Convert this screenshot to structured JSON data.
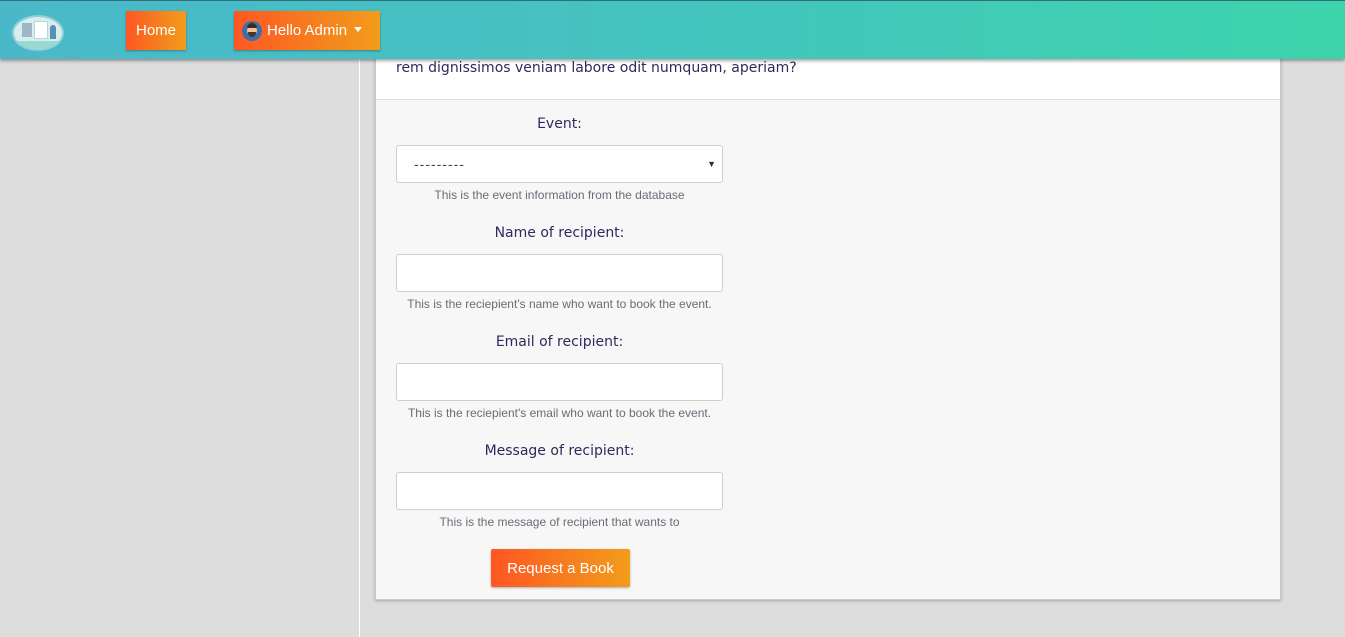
{
  "navbar": {
    "home_label": "Home",
    "user_label": "Hello Admin",
    "logo_icon": "clinic-logo-icon",
    "avatar_icon": "admin-avatar-icon",
    "dropdown_icon": "caret-down-icon",
    "gradient_start": "#4ab8c9",
    "gradient_end": "#3dd4ac"
  },
  "card": {
    "intro_text": "rem dignissimos veniam labore odit numquam, aperiam?"
  },
  "form": {
    "event": {
      "label": "Event:",
      "selected": "---------",
      "help": "This is the event information from the database"
    },
    "name": {
      "label": "Name of recipient:",
      "value": "",
      "help": "This is the reciepient's name who want to book the event."
    },
    "email": {
      "label": "Email of recipient:",
      "value": "",
      "help": "This is the reciepient's email who want to book the event."
    },
    "message": {
      "label": "Message of recipient:",
      "value": "",
      "help": "This is the message of recipient that wants to"
    },
    "submit_label": "Request a Book"
  },
  "colors": {
    "button_start": "#ff5722",
    "button_end": "#f39c1a",
    "label_text": "#2d2a5c",
    "page_bg": "#dddddd"
  }
}
